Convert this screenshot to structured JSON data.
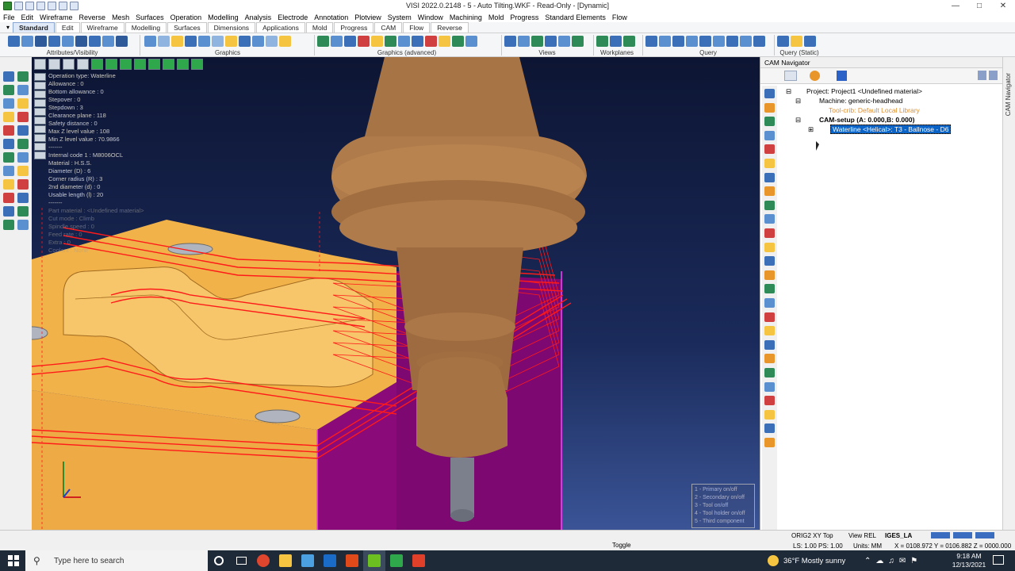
{
  "window": {
    "title": "VISI 2022.0.2148 - 5 - Auto Tilting.WKF - Read-Only - [Dynamic]",
    "minimize": "—",
    "maximize": "□",
    "close": "✕"
  },
  "menu": [
    "File",
    "Edit",
    "Wireframe",
    "Reverse",
    "Mesh",
    "Surfaces",
    "Operation",
    "Modelling",
    "Analysis",
    "Electrode",
    "Annotation",
    "Plotview",
    "System",
    "Window",
    "Machining",
    "Mold",
    "Progress",
    "Standard Elements",
    "Flow"
  ],
  "tabs": [
    "Standard",
    "Edit",
    "Wireframe",
    "Modelling",
    "Surfaces",
    "Dimensions",
    "Applications",
    "Mold",
    "Progress",
    "CAM",
    "Flow",
    "Reverse"
  ],
  "active_tab": "Standard",
  "toolbar_groups": {
    "attributes": "Attributes/Visibility",
    "graphics": "Graphics",
    "graphics_adv": "Graphics (advanced)",
    "views": "Views",
    "workplanes": "Workplanes",
    "query": "Query",
    "query_static": "Query (Static)"
  },
  "operation_info": {
    "lines": [
      "Operation type: Waterline",
      "Allowance : 0",
      "Bottom allowance : 0",
      "Stepover : 0",
      "Stepdown : 3",
      "Clearance plane : 118",
      "Safety distance : 0",
      "Max Z level value : 108",
      "Min Z level value : 70.9866",
      "-------",
      "Internal code 1 : M8006OCL",
      "Material : H.S.S.",
      "Diameter (D) : 6",
      "Corner radius (R) : 3",
      "2nd diameter (d) : 0",
      "Usable length (l) : 20",
      "-------"
    ],
    "faded_lines": [
      "Part material : <Undefined material>",
      "Cut mode : Climb",
      "Spindle speed : 0",
      "Feed rate : 0",
      "Extra : 0",
      "Coolant : None"
    ]
  },
  "legend": [
    "1 - Primary on/off",
    "2 - Secondary on/off",
    "3 - Tool on/off",
    "4 - Tool holder on/off",
    "5 - Third component"
  ],
  "cam_navigator": {
    "title": "CAM Navigator",
    "side_label": "CAM Navigator",
    "tree": {
      "project": "Project: Project1 <Undefined material>",
      "machine": "Machine: generic-headhead",
      "toolcrib": "Tool-crib: Default Local Library",
      "setup": "CAM-setup (A: 0.000,B: 0.000)",
      "operation": "Waterline <Helical>: T3 - Ballnose - D6"
    }
  },
  "status": {
    "toggle": "Toggle",
    "workplane": "ORIG2 XY Top",
    "ls": "LS: 1.00 PS: 1.00",
    "view": "View REL",
    "units": "Units: MM",
    "layer": "IGES_LA",
    "coords": "X = 0108.972 Y = 0106.882 Z = 0000.000"
  },
  "taskbar": {
    "search_placeholder": "Type here to search",
    "weather": "36°F  Mostly sunny",
    "time": "9:18 AM",
    "date": "12/13/2021"
  },
  "colors": {
    "part": "#f2b24a",
    "toolpath": "#ff1a1a",
    "holder": "#a77445",
    "magenta": "#8a0a7a",
    "selection": "#0a64c8"
  }
}
